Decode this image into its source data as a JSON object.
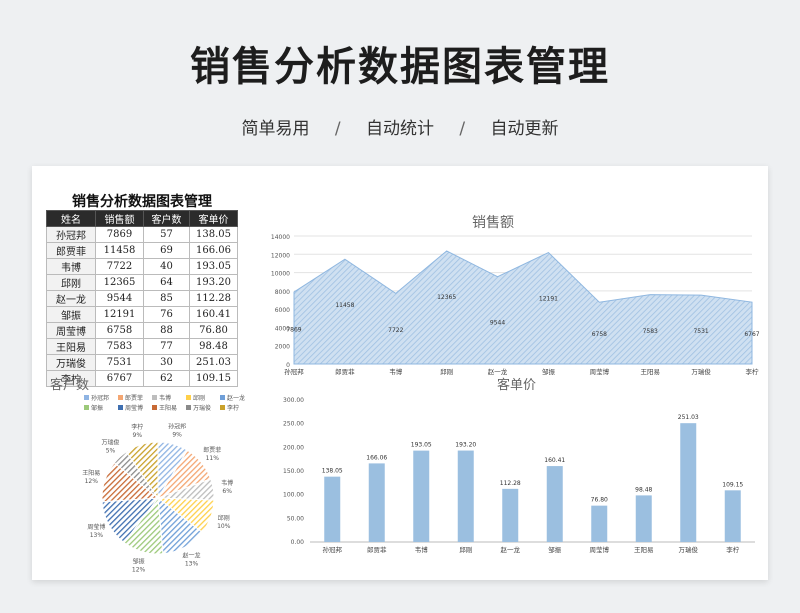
{
  "header": {
    "title": "销售分析数据图表管理",
    "tagline": [
      "简单易用",
      "自动统计",
      "自动更新"
    ],
    "separator": "/"
  },
  "sheet": {
    "title": "销售分析数据图表管理",
    "columns": [
      "姓名",
      "销售额",
      "客户数",
      "客单价"
    ],
    "rows": [
      [
        "孙冠邦",
        "7869",
        "57",
        "138.05"
      ],
      [
        "郎贾菲",
        "11458",
        "69",
        "166.06"
      ],
      [
        "韦博",
        "7722",
        "40",
        "193.05"
      ],
      [
        "邱刚",
        "12365",
        "64",
        "193.20"
      ],
      [
        "赵一龙",
        "9544",
        "85",
        "112.28"
      ],
      [
        "邹振",
        "12191",
        "76",
        "160.41"
      ],
      [
        "周莹博",
        "6758",
        "88",
        "76.80"
      ],
      [
        "王阳易",
        "7583",
        "77",
        "98.48"
      ],
      [
        "万瑞俊",
        "7531",
        "30",
        "251.03"
      ],
      [
        "李柠",
        "6767",
        "62",
        "109.15"
      ]
    ]
  },
  "chart_data": [
    {
      "type": "area",
      "title": "销售额",
      "categories": [
        "孙冠邦",
        "郎贾菲",
        "韦博",
        "邱刚",
        "赵一龙",
        "邹振",
        "周莹博",
        "王阳易",
        "万瑞俊",
        "李柠"
      ],
      "values": [
        7869,
        11458,
        7722,
        12365,
        9544,
        12191,
        6758,
        7583,
        7531,
        6767
      ],
      "ylim": [
        0,
        14000
      ],
      "yticks": [
        0,
        2000,
        4000,
        6000,
        8000,
        10000,
        12000,
        14000
      ],
      "grid": true,
      "color": "#a9c8e6"
    },
    {
      "type": "pie",
      "title": "客户数",
      "categories": [
        "孙冠邦",
        "郎贾菲",
        "韦博",
        "邱刚",
        "赵一龙",
        "邹振",
        "周莹博",
        "王阳易",
        "万瑞俊",
        "李柠"
      ],
      "values": [
        57,
        69,
        40,
        64,
        85,
        76,
        88,
        77,
        30,
        62
      ],
      "percent_labels": [
        "9%",
        "11%",
        "6%",
        "10%",
        "13%",
        "12%",
        "13%",
        "12%",
        "5%",
        "9%"
      ],
      "colors": [
        "#8fb4e3",
        "#f4a672",
        "#bdbdbd",
        "#ffd04a",
        "#6f9fd8",
        "#9cc97a",
        "#3f6fb0",
        "#c86a35",
        "#8a8a8a",
        "#c9a12a"
      ],
      "legend": "top"
    },
    {
      "type": "bar",
      "title": "客单价",
      "categories": [
        "孙冠邦",
        "郎贾菲",
        "韦博",
        "邱刚",
        "赵一龙",
        "邹振",
        "周莹博",
        "王阳易",
        "万瑞俊",
        "李柠"
      ],
      "values": [
        138.05,
        166.06,
        193.05,
        193.2,
        112.28,
        160.41,
        76.8,
        98.48,
        251.03,
        109.15
      ],
      "value_labels": [
        "138.05",
        "166.06",
        "193.05",
        "193.20",
        "112.28",
        "160.41",
        "76.80",
        "98.48",
        "251.03",
        "109.15"
      ],
      "ylim": [
        0,
        300
      ],
      "yticks": [
        "0.00",
        "50.00",
        "100.00",
        "150.00",
        "200.00",
        "250.00",
        "300.00"
      ],
      "color": "#9bbfe0"
    }
  ]
}
